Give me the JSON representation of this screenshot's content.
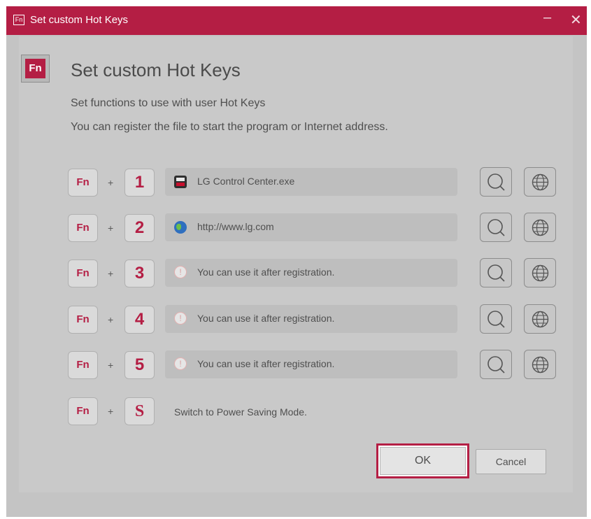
{
  "window": {
    "title": "Set custom Hot Keys",
    "title_icon": "Fn",
    "minimize_label": "–",
    "close_label": "✕"
  },
  "header": {
    "icon_label": "Fn",
    "title": "Set custom Hot Keys",
    "description_line1": "Set functions to use with user Hot Keys",
    "description_line2": "You can register the file to start the program or Internet address."
  },
  "hotkeys": [
    {
      "fn": "Fn",
      "plus": "+",
      "key": "1",
      "value": "LG Control Center.exe",
      "icon": "lg-control-center-app-icon"
    },
    {
      "fn": "Fn",
      "plus": "+",
      "key": "2",
      "value": "http://www.lg.com",
      "icon": "globe-color-icon"
    },
    {
      "fn": "Fn",
      "plus": "+",
      "key": "3",
      "value": "You can use it after registration.",
      "icon": "warning-icon",
      "icon_glyph": "!"
    },
    {
      "fn": "Fn",
      "plus": "+",
      "key": "4",
      "value": "You can use it after registration.",
      "icon": "warning-icon",
      "icon_glyph": "!"
    },
    {
      "fn": "Fn",
      "plus": "+",
      "key": "5",
      "value": "You can use it after registration.",
      "icon": "warning-icon",
      "icon_glyph": "!"
    },
    {
      "fn": "Fn",
      "plus": "+",
      "key": "S",
      "value": "Switch to Power Saving Mode."
    }
  ],
  "row_buttons": {
    "search_icon": "search-icon",
    "web_icon": "globe-icon"
  },
  "actions": {
    "ok_label": "OK",
    "cancel_label": "Cancel"
  },
  "colors": {
    "accent": "#b41e44",
    "window_bg": "#c4c4c4",
    "field_bg": "#bebebe",
    "text": "#4f4f4f"
  }
}
